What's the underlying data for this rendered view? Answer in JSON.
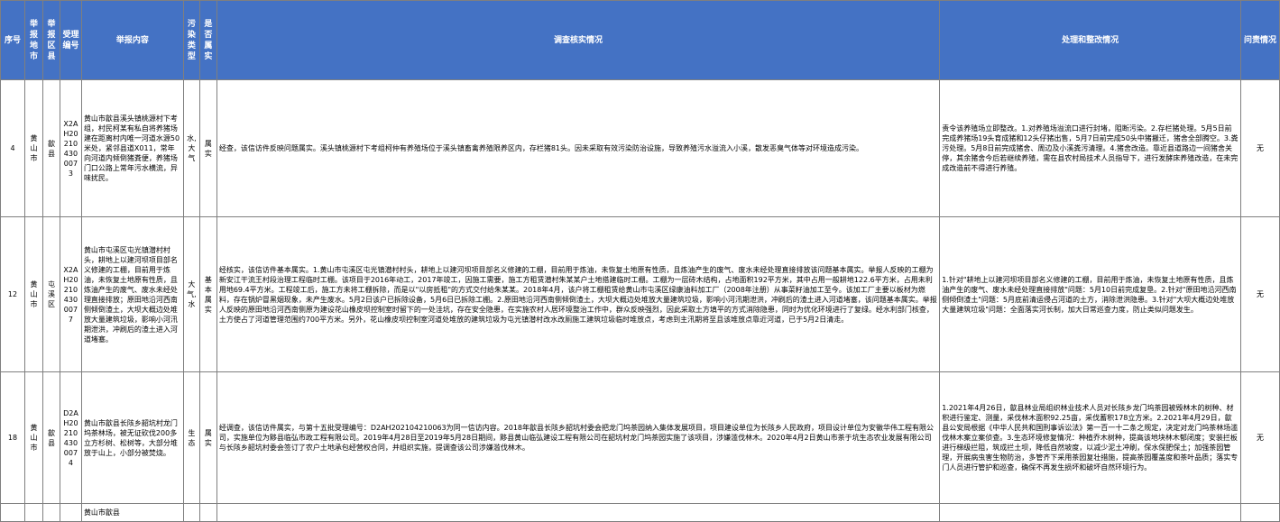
{
  "headers": {
    "seq": "序号",
    "city": "举报地市",
    "county": "举报区县",
    "accept_no": "受理编号",
    "report_content": "举报内容",
    "pollution_type": "污染类型",
    "is_true": "是否属实",
    "investigation": "调查核实情况",
    "handling": "处理和整改情况",
    "accountability": "问责情况"
  },
  "rows": [
    {
      "seq": "4",
      "city": "黄山市",
      "county": "歙县",
      "accept_no": "X2AH20210430007 3",
      "report_content": "黄山市歙县溪头镇桃源村下考组，村民柯某有私自将养猪场建在距离村内唯一河道水源50米处，紧邻县道X011，常年向河道内倾倒猪粪便，养猪场门口公路上常年污水横流，异味扰民。",
      "pollution_type": "水,大气",
      "is_true": "属实",
      "investigation": "经查，该信访件反映问题属实。溪头镇桃源村下考组柯仲有养殖场位于溪头镇畜禽养殖限养区内，存栏猪81头。因未采取有效污染防治设施，导致养殖污水溢流入小溪，散发恶臭气体等对环境造成污染。",
      "handling": "责令该养殖场立即整改。1.对养殖场溢流口进行封堵，阻断污染。2.存栏猪处理。5月5日前完成养猪场19头育成猪和12头仔猪出售，5月7日前完成50头中猪搬迁，猪舍全部腾空。3.粪污处理。5月8日前完成猪舍、周边及小溪粪污清理。4.猪舍改造。靠近县道路边一间猪舍关停，其余猪舍今后若继续养殖，需在县农村局技术人员指导下，进行发酵床养殖改造，在未完成改造前不得进行养殖。",
      "accountability": "无"
    },
    {
      "seq": "12",
      "city": "黄山市",
      "county": "屯溪区",
      "accept_no": "X2AH20210430007 7",
      "report_content": "黄山市屯溪区屯光镇潜村村头，耕地上以建河坝项目部名义修建的工棚，目前用于炼油，未恢复土地原有性质，且炼油产生的废气、废水未经处理直接排放；原田地沿河西南侧倾倒渣土，大坝大概边处堆放大量建筑垃圾，影响小河汛期泄洪，冲刷后的渣土进入河道堵塞。",
      "pollution_type": "大气,水",
      "is_true": "基本属实",
      "investigation": "经核实，该信访件基本属实。1.黄山市屯溪区屯光镇潜村村头，耕地上以建河坝项目部名义修建的工棚，目前用于炼油，未恢复土地原有性质，且炼油产生的废气、废水未经处理直接排放该问题基本属实。举报人反映的工棚为新安江干流王村段治理工程临时工棚。该项目于2016年动工，2017年竣工，因施工需要，施工方租赁潜村朱某某户土地搭建临时工棚。工棚为一层砖木结构，占地面积192平方米，其中占用一般耕地122.6平方米，占用未利用地69.4平方米。工程竣工后，施工方未将工棚拆除，而是以\"以房抵租\"的方式交付给朱某某。2018年4月，该户将工棚租赁给黄山市屯溪区绿康油料加工厂（2008年注册）从事菜籽油加工至今。该加工厂主要以板材为燃料，存在锅炉冒黑烟现象，未产生废水。5月2日该户已拆除设备，5月6日已拆除工棚。2.原田地沿河西南侧倾倒渣土，大坝大概边处堆放大量建筑垃圾，影响小河汛期泄洪，冲刷后的渣土进入河道堵塞，该问题基本属实。举报人反映的原田地沿河西南侧原为建设花山橡皮坝控制室时留下的一处洼坑，存在安全隐患，在实施农村人居环境整治工作中，群众反映强烈，因此采取土方填平的方式消除隐患，同时为优化环境进行了复绿。经水利部门核查，土方使占了河道管理范围约700平方米。另外，花山橡皮坝控制室河道处堆放的建筑垃圾为屯光镇潜村改水改厕施工建筑垃圾临时堆放点，考虑到主汛期将至且该堆放点靠近河道，已于5月2日清走。",
      "handling": "1.针对\"耕地上以建河坝项目部名义修建的工棚，目前用于炼油，未恢复土地原有性质，且炼油产生的废气、废水未经处理直接排放\"问题：5月10日前完成复垦。2.针对\"原田地沿河西南侧倾倒渣土\"问题：5月底前清运侵占河道的土方，消除泄洪隐患。3.针对\"大坝大概边处堆放大量建筑垃圾\"问题：全面落实河长制，加大日常巡查力度，防止类似问题发生。",
      "accountability": "无"
    },
    {
      "seq": "18",
      "city": "黄山市",
      "county": "歙县",
      "accept_no": "D2AH20210430007 4",
      "report_content": "黄山市歙县长陔乡韶坑村龙门坞茶林场，被无证砍伐200多立方杉树、松树等，大部分堆放于山上，小部分被焚烧。",
      "pollution_type": "生态",
      "is_true": "属实",
      "investigation": "经调查，该信访件属实，与第十五批受理编号：D2AH202104210063为同一信访内容。2018年歙县长陔乡韶坑村委会把龙门坞茶园纳入集体发展项目，项目建设单位为长陔乡人民政府，项目设计单位为安徽华伟工程有限公司，实施单位为黟县临弘市政工程有限公司。2019年4月28日至2019年5月28日期间，黟县黄山临弘建设工程有限公司在韶坑村龙门坞茶园实施了该项目，涉嫌滥伐林木。2020年4月2日黄山市茶于坑生态农业发展有限公司与长陔乡韶坑村委会签订了农户土地承包经营权合同，并组织实施，提调查该公司涉嫌滥伐林木。",
      "handling": "1.2021年4月26日，歙县林业局组织林业技术人员对长陔乡龙门坞茶园被毁林木的树种、材积进行鉴定、测量，采伐林木面积92.25亩，采伐蓄积178立方米。2.2021年4月29日，歙县公安局根据《中华人民共和国刑事诉讼法》第一百一十二条之规定，决定对龙门坞茶林场滥伐林木案立案侦查。3.生态环境修复情况：种植乔木树种，提高该地块林木郁闭度；安装拦板进行梯级拦阻，筑成拦土坝，降低自然坡度，以减少泥土冲刷，保水保肥保土；加强茶园管理，开展病虫害生物防治，多管齐下采用茶园复壮措施，提高茶园覆盖度和茶叶品质；落实专门人员进行管护和巡查，确保不再发生损坏和破坏自然环境行为。",
      "accountability": "无"
    },
    {
      "seq": "",
      "city": "",
      "county": "",
      "accept_no": "",
      "report_content": "黄山市歙县",
      "pollution_type": "",
      "is_true": "",
      "investigation": "",
      "handling": "",
      "accountability": ""
    }
  ],
  "colors": {
    "header_bg": "#4472c4",
    "header_text": "#ffffff",
    "border": "#7f7f7f"
  }
}
